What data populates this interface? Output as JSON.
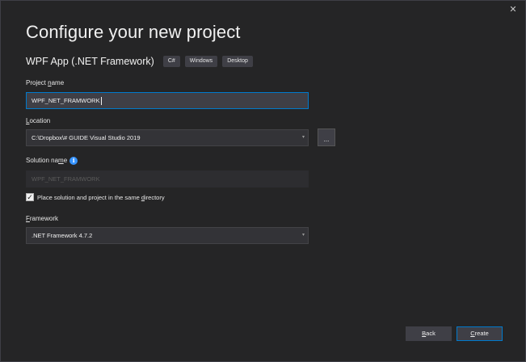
{
  "window": {
    "close_glyph": "✕"
  },
  "header": {
    "title": "Configure your new project",
    "template_name": "WPF App (.NET Framework)",
    "tags": [
      "C#",
      "Windows",
      "Desktop"
    ]
  },
  "form": {
    "project_name": {
      "label_prefix": "Project ",
      "label_access": "n",
      "label_suffix": "ame",
      "value": "WPF_NET_FRAMWORK"
    },
    "location": {
      "label_access": "L",
      "label_suffix": "ocation",
      "value": "C:\\Dropbox\\# GUIDE Visual Studio 2019",
      "browse_label": "..."
    },
    "solution_name": {
      "label_prefix": "Solution na",
      "label_access": "m",
      "label_suffix": "e",
      "value": "WPF_NET_FRAMWORK",
      "info_glyph": "i"
    },
    "same_directory": {
      "checked": true,
      "check_glyph": "✓",
      "label_prefix": "Place solution and project in the same ",
      "label_access": "d",
      "label_suffix": "irectory"
    },
    "framework": {
      "label_access": "F",
      "label_suffix": "ramework",
      "value": ".NET Framework 4.7.2"
    },
    "dropdown_glyph": "▾"
  },
  "footer": {
    "back": {
      "access": "B",
      "suffix": "ack"
    },
    "create": {
      "access": "C",
      "suffix": "reate"
    }
  },
  "colors": {
    "background": "#252526",
    "accent": "#007acc",
    "field": "#333337"
  }
}
